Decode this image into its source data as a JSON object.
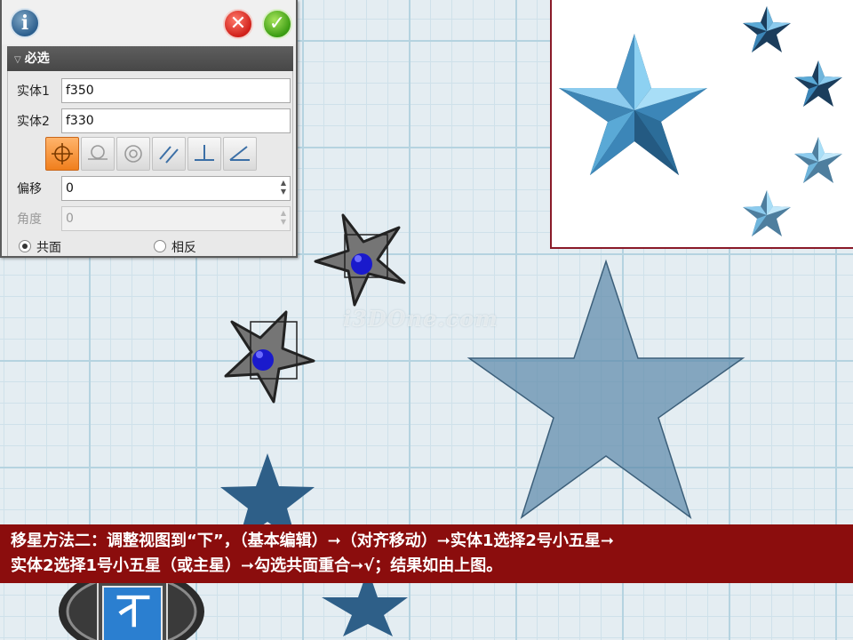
{
  "dialog": {
    "section_title": "必选",
    "entity1_label": "实体1",
    "entity1_value": "f350",
    "entity2_label": "实体2",
    "entity2_value": "f330",
    "offset_label": "偏移",
    "offset_value": "0",
    "angle_label": "角度",
    "angle_value": "0",
    "coplanar_label": "共面",
    "opposite_label": "相反",
    "tool_icons": [
      "point-align-icon",
      "tangent-icon",
      "concentric-icon",
      "parallel-icon",
      "perpendicular-icon",
      "angle-icon"
    ],
    "active_tool": "point-align-icon",
    "selected_radio": "coplanar"
  },
  "viewport": {
    "watermark": "i3DOne.com",
    "view_cube_face": "下",
    "star_color": "#2e5f88",
    "preview_star_color": "#5aa9d6"
  },
  "caption": {
    "line1": "移星方法二：调整视图到“下”，（基本编辑）➞（对齐移动）➞实体1选择2号小五星➞",
    "line2": "实体2选择1号小五星（或主星）➞勾选共面重合➞√；结果如由上图。"
  }
}
